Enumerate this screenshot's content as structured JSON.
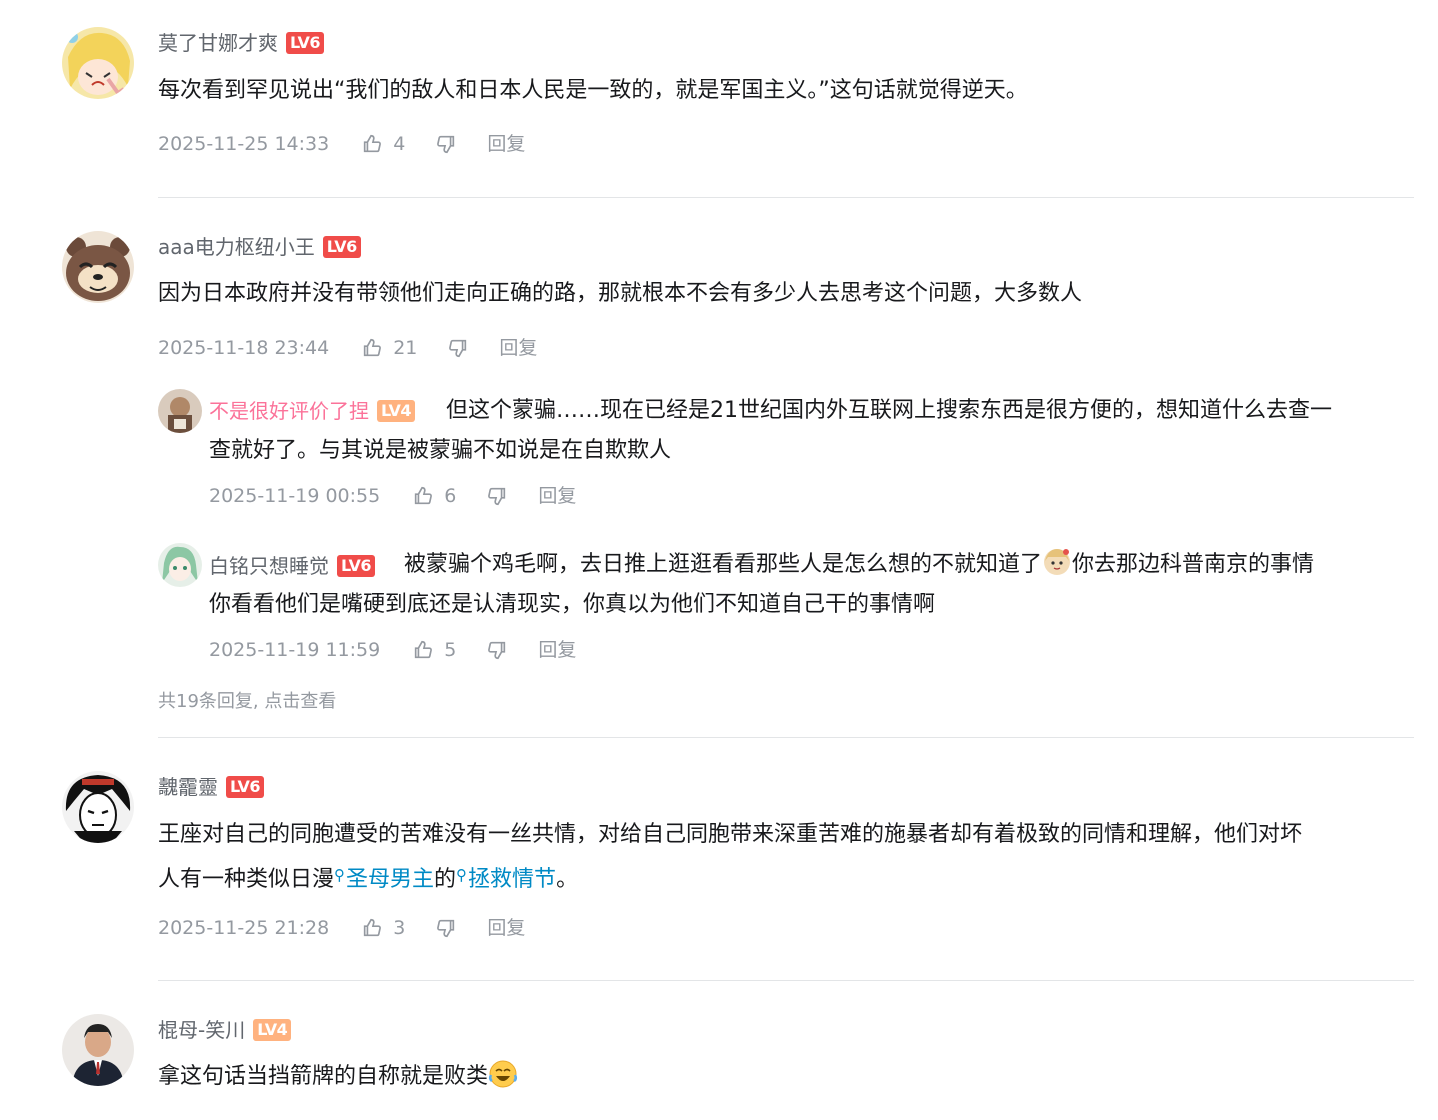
{
  "comments": [
    {
      "user": "莫了甘娜才爽",
      "level": "LV6",
      "text": "每次看到罕见说出“我们的敌人和日本人民是一致的，就是军国主义。”这句话就觉得逆天。",
      "time": "2025-11-25 14:33",
      "likes": "4",
      "reply_label": "回复"
    },
    {
      "user": "aaa电力枢纽小王",
      "level": "LV6",
      "text": "因为日本政府并没有带领他们走向正确的路，那就根本不会有多少人去思考这个问题，大多数人",
      "time": "2025-11-18 23:44",
      "likes": "21",
      "reply_label": "回复",
      "replies": [
        {
          "user": "不是很好评价了捏",
          "level": "LV4",
          "text_line1": "但这个蒙骗……现在已经是21世纪国内外互联网上搜索东西是很方便的，想知道什么去查一",
          "text_line2": "查就好了。与其说是被蒙骗不如说是在自欺欺人",
          "time": "2025-11-19 00:55",
          "likes": "6",
          "reply_label": "回复"
        },
        {
          "user": "白铭只想睡觉",
          "level": "LV6",
          "text_line1_a": "被蒙骗个鸡毛啊，去日推上逛逛看看那些人是怎么想的不就知道了",
          "text_line1_b": "你去那边科普南京的事情",
          "text_line2": "你看看他们是嘴硬到底还是认清现实，你真以为他们不知道自己干的事情啊",
          "time": "2025-11-19 11:59",
          "likes": "5",
          "reply_label": "回复"
        }
      ],
      "more_replies": "共19条回复, 点击查看"
    },
    {
      "user": "魗靇靈",
      "level": "LV6",
      "text_line1": "王座对自己的同胞遭受的苦难没有一丝共情，对给自己同胞带来深重苦难的施暴者却有着极致的同情和理解，他们对坏",
      "text_line2_a": "人有一种类似日漫",
      "link1": "圣母男主",
      "text_line2_b": "的",
      "link2": "拯救情节",
      "text_line2_c": "。",
      "time": "2025-11-25 21:28",
      "likes": "3",
      "reply_label": "回复"
    },
    {
      "user": "棍母-笑川",
      "level": "LV4",
      "text": "拿这句话当挡箭牌的自称就是败类"
    }
  ],
  "colors": {
    "lv6": "#f04c49",
    "lv4": "#ffb27f",
    "pink_name": "#fb7299",
    "link": "#008ac5",
    "meta": "#9499a0"
  },
  "icons": {
    "like": "thumb-up-icon",
    "dislike": "thumb-down-icon",
    "search": "search-icon"
  }
}
